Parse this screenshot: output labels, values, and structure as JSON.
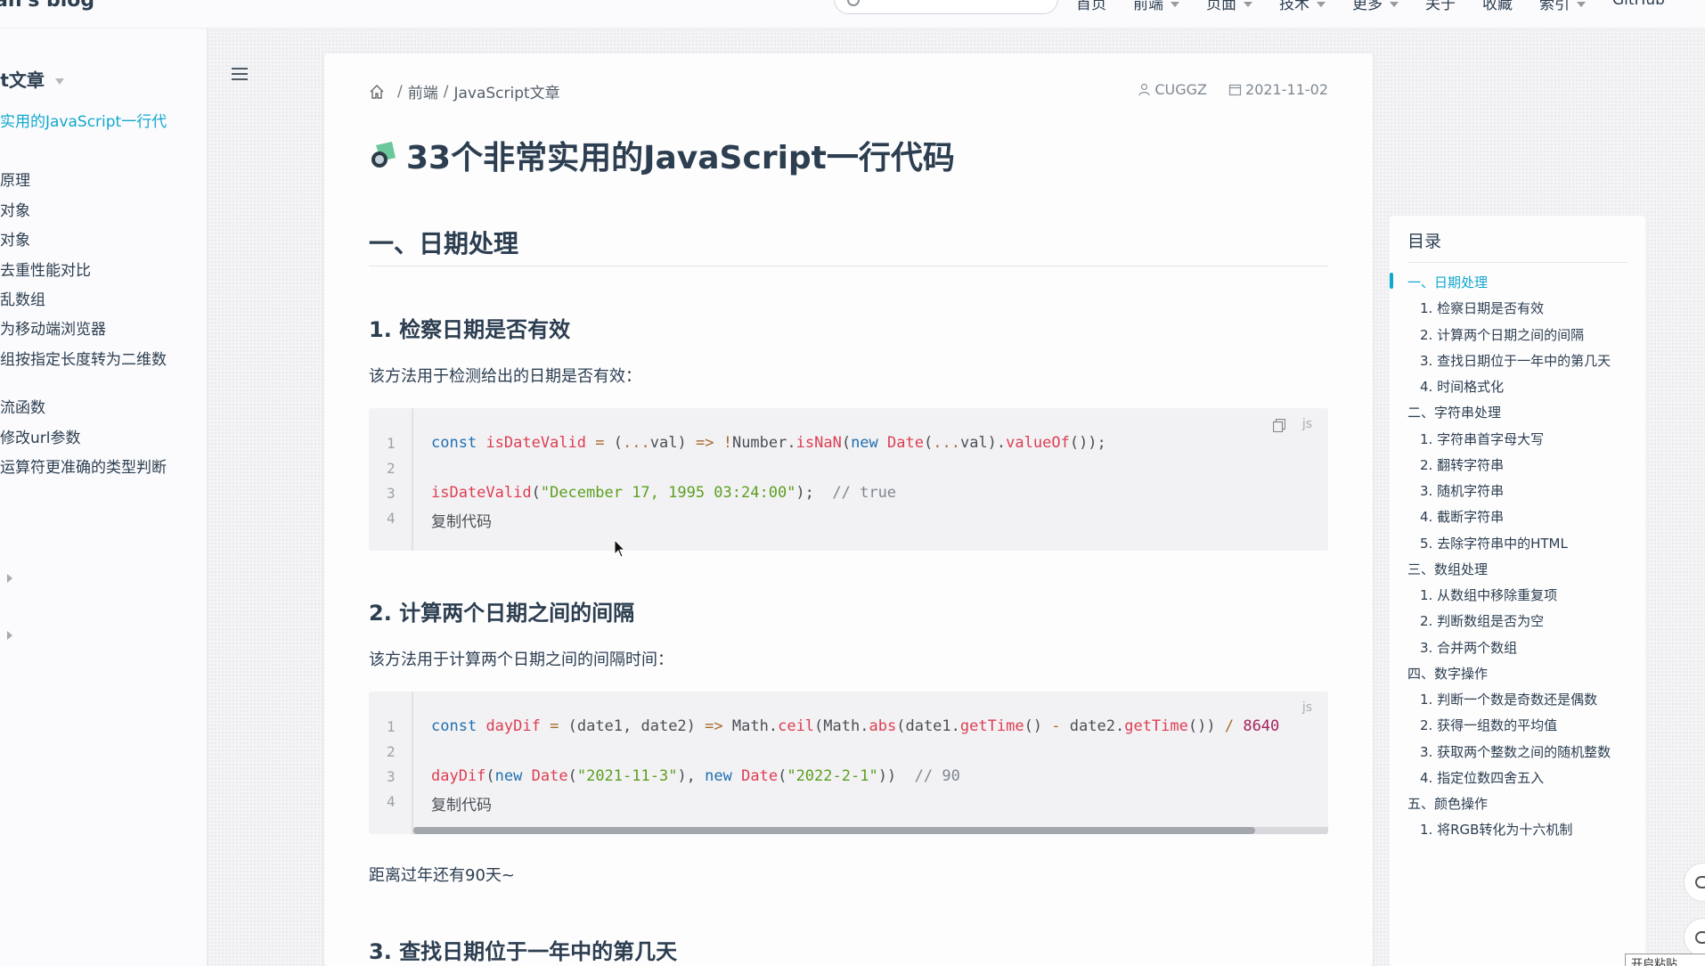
{
  "header": {
    "brand": "an's blog",
    "nav": [
      {
        "label": "首页",
        "caret": false
      },
      {
        "label": "前端",
        "caret": true
      },
      {
        "label": "页面",
        "caret": true
      },
      {
        "label": "技术",
        "caret": true
      },
      {
        "label": "更多",
        "caret": true
      },
      {
        "label": "关于",
        "caret": false
      },
      {
        "label": "收藏",
        "caret": false
      },
      {
        "label": "索引",
        "caret": true
      },
      {
        "label": "GitHub",
        "caret": false
      }
    ]
  },
  "sidebar": {
    "group_title": "pt文章",
    "active_item": "实用的JavaScript一行代",
    "items": [
      {
        "label": "原理"
      },
      {
        "label": "对象"
      },
      {
        "label": "对象"
      },
      {
        "label": "去重性能对比"
      },
      {
        "label": "乱数组"
      },
      {
        "label": "为移动端浏览器"
      },
      {
        "label": "组按指定长度转为二维数"
      },
      {
        "label": "流函数"
      },
      {
        "label": "修改url参数"
      },
      {
        "label": "运算符更准确的类型判断"
      }
    ]
  },
  "article": {
    "breadcrumb": {
      "crumb1": "前端",
      "crumb2": "JavaScript文章",
      "separator": "/"
    },
    "author": "CUGGZ",
    "date": "2021-11-02",
    "title": "33个非常实用的JavaScript一行代码",
    "section1_heading": "一、日期处理",
    "item1_heading": "1. 检察日期是否有效",
    "item1_desc": "该方法用于检测给出的日期是否有效：",
    "item2_heading": "2. 计算两个日期之间的间隔",
    "item2_desc": "该方法用于计算两个日期之间的间隔时间：",
    "item2_note": "距离过年还有90天~",
    "item3_heading": "3. 查找日期位于一年中的第几天",
    "code1": {
      "lang": "js",
      "line_numbers": [
        "1",
        "2",
        "3",
        "4"
      ],
      "line1": {
        "kw1": "const",
        "name": "isDateValid",
        "op": "=",
        "p1": "(",
        "spread1": "...",
        "arg": "val",
        "p2": ")",
        "arrow": "=>",
        "bang": "!",
        "obj": "Number",
        "dot": ".",
        "method": "isNaN",
        "p3": "(",
        "kw2": "new",
        "cls": "Date",
        "p4": "(",
        "spread2": "...",
        "arg2": "val",
        "p5": ")",
        "dot2": ".",
        "method2": "valueOf",
        "p6": "());"
      },
      "line3": {
        "call": "isDateValid",
        "p1": "(",
        "str": "\"December 17, 1995 03:24:00\"",
        "p2": ");",
        "comment": "// true"
      },
      "line4": "复制代码"
    },
    "code2": {
      "lang": "js",
      "line_numbers": [
        "1",
        "2",
        "3",
        "4"
      ],
      "line1": {
        "kw1": "const",
        "name": "dayDif",
        "op": "=",
        "params": "(date1, date2)",
        "arrow": "=>",
        "obj1": "Math",
        "method1": "ceil",
        "obj2": "Math",
        "method2": "abs",
        "arg1": "date1",
        "m3": "getTime",
        "minus": "-",
        "arg2": "date2",
        "m4": "getTime",
        "div": "/",
        "num": "8640"
      },
      "line3": {
        "call": "dayDif",
        "kw1": "new",
        "cls1": "Date",
        "str1": "\"2021-11-3\"",
        "kw2": "new",
        "cls2": "Date",
        "str2": "\"2022-2-1\"",
        "comment": "// 90"
      },
      "line4": "复制代码"
    }
  },
  "toc": {
    "title": "目录",
    "items": [
      {
        "label": "一、日期处理",
        "level": 1,
        "active": true
      },
      {
        "label": "1. 检察日期是否有效",
        "level": 2
      },
      {
        "label": "2. 计算两个日期之间的间隔",
        "level": 2
      },
      {
        "label": "3. 查找日期位于一年中的第几天",
        "level": 2
      },
      {
        "label": "4. 时间格式化",
        "level": 2
      },
      {
        "label": "二、字符串处理",
        "level": 1
      },
      {
        "label": "1. 字符串首字母大写",
        "level": 2
      },
      {
        "label": "2. 翻转字符串",
        "level": 2
      },
      {
        "label": "3. 随机字符串",
        "level": 2
      },
      {
        "label": "4. 截断字符串",
        "level": 2
      },
      {
        "label": "5. 去除字符串中的HTML",
        "level": 2
      },
      {
        "label": "三、数组处理",
        "level": 1
      },
      {
        "label": "1. 从数组中移除重复项",
        "level": 2
      },
      {
        "label": "2. 判断数组是否为空",
        "level": 2
      },
      {
        "label": "3. 合并两个数组",
        "level": 2
      },
      {
        "label": "四、数字操作",
        "level": 1
      },
      {
        "label": "1. 判断一个数是奇数还是偶数",
        "level": 2
      },
      {
        "label": "2. 获得一组数的平均值",
        "level": 2
      },
      {
        "label": "3. 获取两个整数之间的随机整数",
        "level": 2
      },
      {
        "label": "4. 指定位数四舍五入",
        "level": 2
      },
      {
        "label": "五、颜色操作",
        "level": 1
      },
      {
        "label": "1. 将RGB转化为十六机制",
        "level": 2
      }
    ]
  },
  "bottom_tag": "开启粘贴",
  "colors": {
    "accent": "#11a8cd",
    "text": "#2c3e50"
  }
}
